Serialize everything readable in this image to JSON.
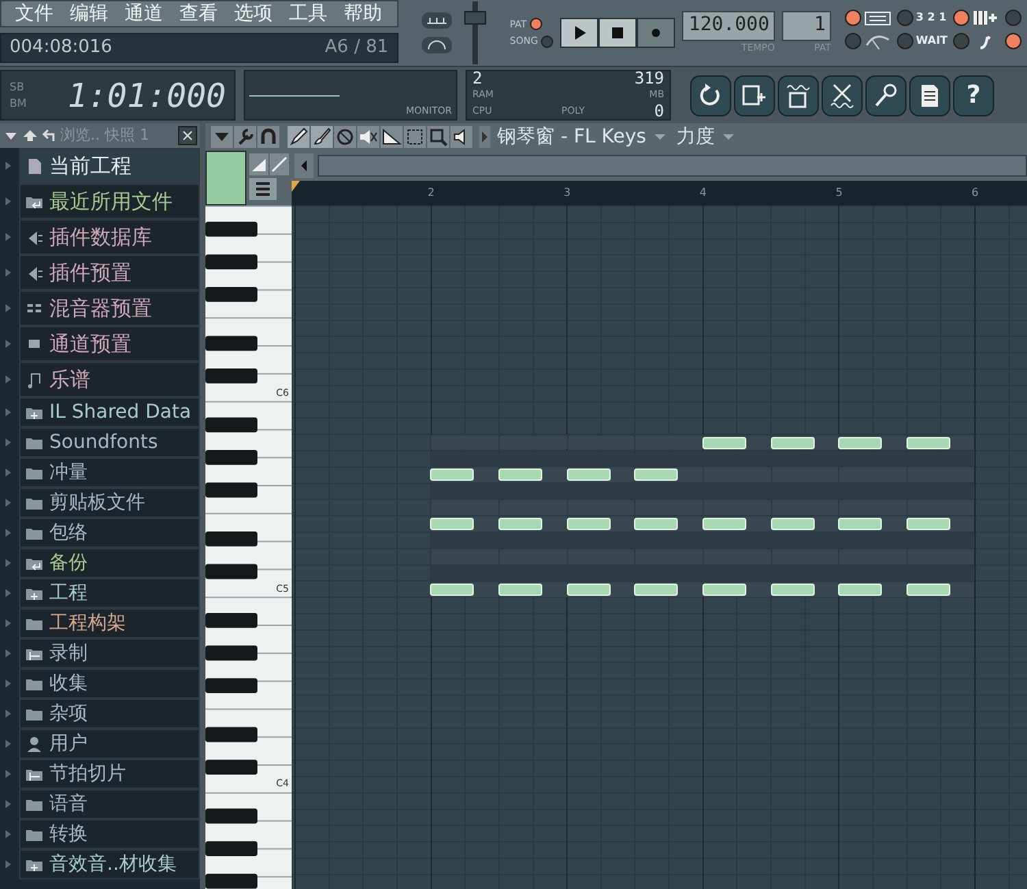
{
  "menu": [
    "文件",
    "编辑",
    "通道",
    "查看",
    "选项",
    "工具",
    "帮助"
  ],
  "hint_bar": {
    "time": "004:08:016",
    "note": "A6 / 81"
  },
  "clock": {
    "labels": [
      "SB",
      "BM"
    ],
    "time": "1:01:000"
  },
  "monitor": {
    "label": "MONITOR"
  },
  "cpu_panel": {
    "pattern": "2",
    "memory": "319",
    "ram_label": "RAM",
    "mb_label": "MB",
    "cpu_label": "CPU",
    "poly_label": "POLY",
    "poly": "0"
  },
  "transport": {
    "modes": [
      {
        "label": "PAT",
        "selected": true
      },
      {
        "label": "SONG",
        "selected": false
      }
    ],
    "buttons": [
      {
        "kind": "play"
      },
      {
        "kind": "stop"
      },
      {
        "kind": "record"
      }
    ],
    "tempo": "120.000",
    "tempo_label": "TEMPO",
    "pattern": "1",
    "pattern_label": "PAT"
  },
  "toggles": [
    {
      "kind": "typing",
      "on": true
    },
    {
      "kind": "countdown",
      "label": "3 2 1",
      "on": false
    },
    {
      "kind": "step",
      "on": true
    },
    {
      "kind": "blank",
      "on": false
    },
    {
      "kind": "metronome",
      "on": false
    },
    {
      "kind": "wait",
      "label": "WAIT",
      "on": false
    },
    {
      "kind": "foot",
      "on": false
    },
    {
      "kind": "blank",
      "on": true
    }
  ],
  "toolbar": [
    {
      "kind": "undo"
    },
    {
      "kind": "save-new"
    },
    {
      "kind": "save-audio"
    },
    {
      "kind": "cut"
    },
    {
      "kind": "mic"
    },
    {
      "kind": "document"
    },
    {
      "kind": "help",
      "label": "?"
    }
  ],
  "browser": {
    "title": "浏览.. 快照 1",
    "items": [
      {
        "label": "当前工程",
        "kind": "file",
        "color": "#e8eef0",
        "selected": true
      },
      {
        "label": "最近所用文件",
        "kind": "folder-return",
        "color": "#a8c890",
        "selected": false
      },
      {
        "label": "插件数据库",
        "kind": "plugin",
        "color": "#d0a8b8",
        "selected": false
      },
      {
        "label": "插件预置",
        "kind": "plugin",
        "color": "#d0a8b8",
        "selected": false
      },
      {
        "label": "混音器预置",
        "kind": "mixer",
        "color": "#d0a8b8",
        "selected": false
      },
      {
        "label": "通道预置",
        "kind": "channel",
        "color": "#d0a8b8",
        "selected": false
      },
      {
        "label": "乐谱",
        "kind": "note",
        "color": "#d0a8b8",
        "selected": false
      },
      {
        "label": "IL Shared Data",
        "kind": "folder-plus",
        "color": "#a8ccc4",
        "selected": false
      },
      {
        "label": "Soundfonts",
        "kind": "folder",
        "color": "#a8b8c8",
        "selected": false
      },
      {
        "label": "冲量",
        "kind": "folder",
        "color": "#a8b8c8",
        "selected": false
      },
      {
        "label": "剪贴板文件",
        "kind": "folder",
        "color": "#a8b8c8",
        "selected": false
      },
      {
        "label": "包络",
        "kind": "folder",
        "color": "#a8b8c8",
        "selected": false
      },
      {
        "label": "备份",
        "kind": "folder-return",
        "color": "#a8c890",
        "selected": false
      },
      {
        "label": "工程",
        "kind": "folder-plus",
        "color": "#a8ccc4",
        "selected": false
      },
      {
        "label": "工程构架",
        "kind": "folder",
        "color": "#d8a890",
        "selected": false
      },
      {
        "label": "录制",
        "kind": "folder-slice",
        "color": "#a8b8c8",
        "selected": false
      },
      {
        "label": "收集",
        "kind": "folder",
        "color": "#a8b8c8",
        "selected": false
      },
      {
        "label": "杂项",
        "kind": "folder",
        "color": "#a8b8c8",
        "selected": false
      },
      {
        "label": "用户",
        "kind": "user",
        "color": "#a8b8c8",
        "selected": false
      },
      {
        "label": "节拍切片",
        "kind": "folder-slice",
        "color": "#a8b8c8",
        "selected": false
      },
      {
        "label": "语音",
        "kind": "folder",
        "color": "#a8b8c8",
        "selected": false
      },
      {
        "label": "转换",
        "kind": "folder",
        "color": "#a8b8c8",
        "selected": false
      },
      {
        "label": "音效音..材收集",
        "kind": "folder-plus",
        "color": "#a8ccc4",
        "selected": false
      }
    ]
  },
  "master_volume": {
    "level": 0.8
  },
  "piano_roll": {
    "title": "钢琴窗 - FL Keys",
    "target": "力度",
    "ruler": [
      "2",
      "3",
      "4",
      "5",
      "6"
    ],
    "key_labels": [
      "C6",
      "C5",
      "C4"
    ],
    "note_rows": [
      {
        "steps": [
          false,
          false,
          false,
          false,
          true,
          true,
          true,
          true
        ]
      },
      {
        "steps": [
          false,
          false,
          false,
          false,
          false,
          false,
          false,
          false
        ]
      },
      {
        "steps": [
          true,
          true,
          true,
          true,
          false,
          false,
          false,
          false
        ]
      },
      {
        "steps": [
          false,
          false,
          false,
          false,
          false,
          false,
          false,
          false
        ]
      },
      {
        "steps": [
          false,
          false,
          false,
          false,
          false,
          false,
          false,
          false
        ]
      },
      {
        "steps": [
          true,
          true,
          true,
          true,
          true,
          true,
          true,
          true
        ]
      },
      {
        "steps": [
          false,
          false,
          false,
          false,
          false,
          false,
          false,
          false
        ]
      },
      {
        "steps": [
          false,
          false,
          false,
          false,
          false,
          false,
          false,
          false
        ]
      },
      {
        "steps": [
          false,
          false,
          false,
          false,
          false,
          false,
          false,
          false
        ]
      },
      {
        "steps": [
          true,
          true,
          true,
          true,
          true,
          true,
          true,
          true
        ]
      }
    ]
  }
}
